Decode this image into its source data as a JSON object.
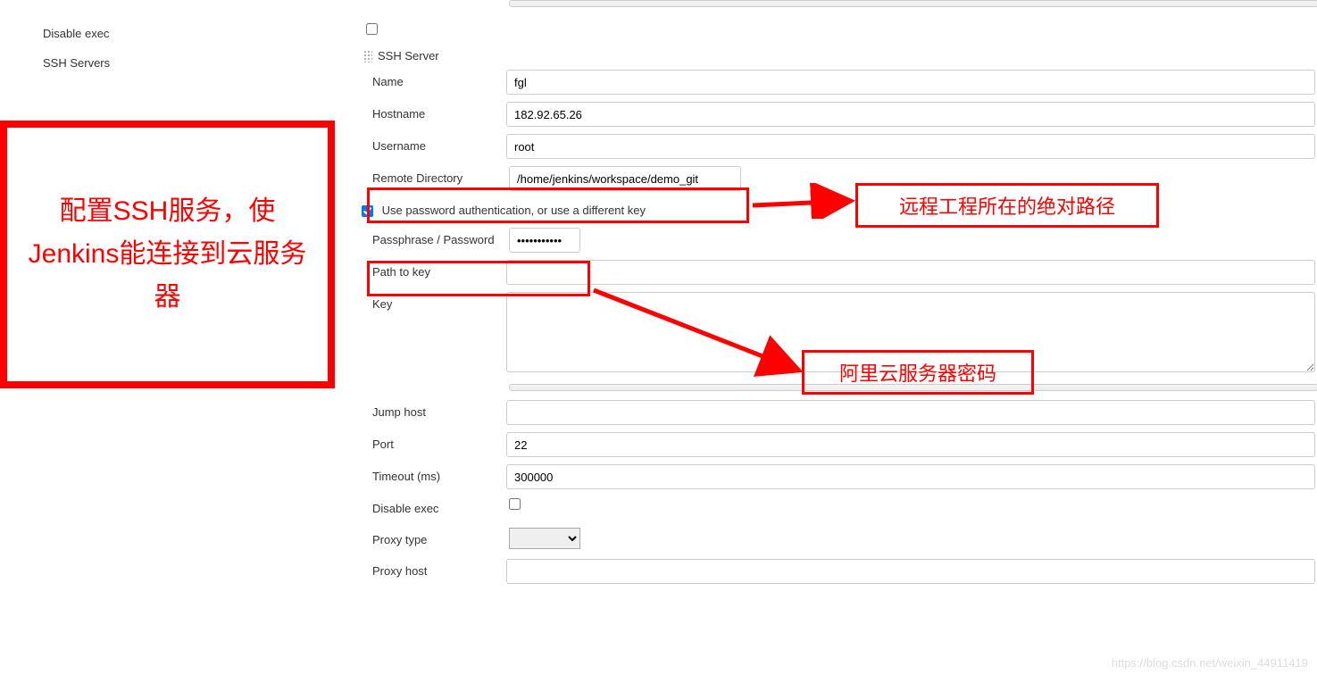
{
  "left": {
    "disable_exec_label": "Disable exec",
    "ssh_servers_label": "SSH Servers"
  },
  "ssh": {
    "header": "SSH Server",
    "name_label": "Name",
    "name_value": "fgl",
    "hostname_label": "Hostname",
    "hostname_value": "182.92.65.26",
    "username_label": "Username",
    "username_value": "root",
    "remote_dir_label": "Remote Directory",
    "remote_dir_value": "/home/jenkins/workspace/demo_git",
    "use_pw_label": "Use password authentication, or use a different key",
    "passphrase_label": "Passphrase / Password",
    "passphrase_value": "•••••••••••",
    "path_to_key_label": "Path to key",
    "path_to_key_value": "",
    "key_label": "Key",
    "key_value": "",
    "jump_host_label": "Jump host",
    "jump_host_value": "",
    "port_label": "Port",
    "port_value": "22",
    "timeout_label": "Timeout (ms)",
    "timeout_value": "300000",
    "disable_exec_label2": "Disable exec",
    "proxy_type_label": "Proxy type",
    "proxy_host_label": "Proxy host",
    "proxy_host_value": ""
  },
  "annotations": {
    "main": "配置SSH服务，使Jenkins能连接到云服务器",
    "remote_path": "远程工程所在的绝对路径",
    "password": "阿里云服务器密码"
  },
  "watermark": "https://blog.csdn.net/weixin_44911419"
}
